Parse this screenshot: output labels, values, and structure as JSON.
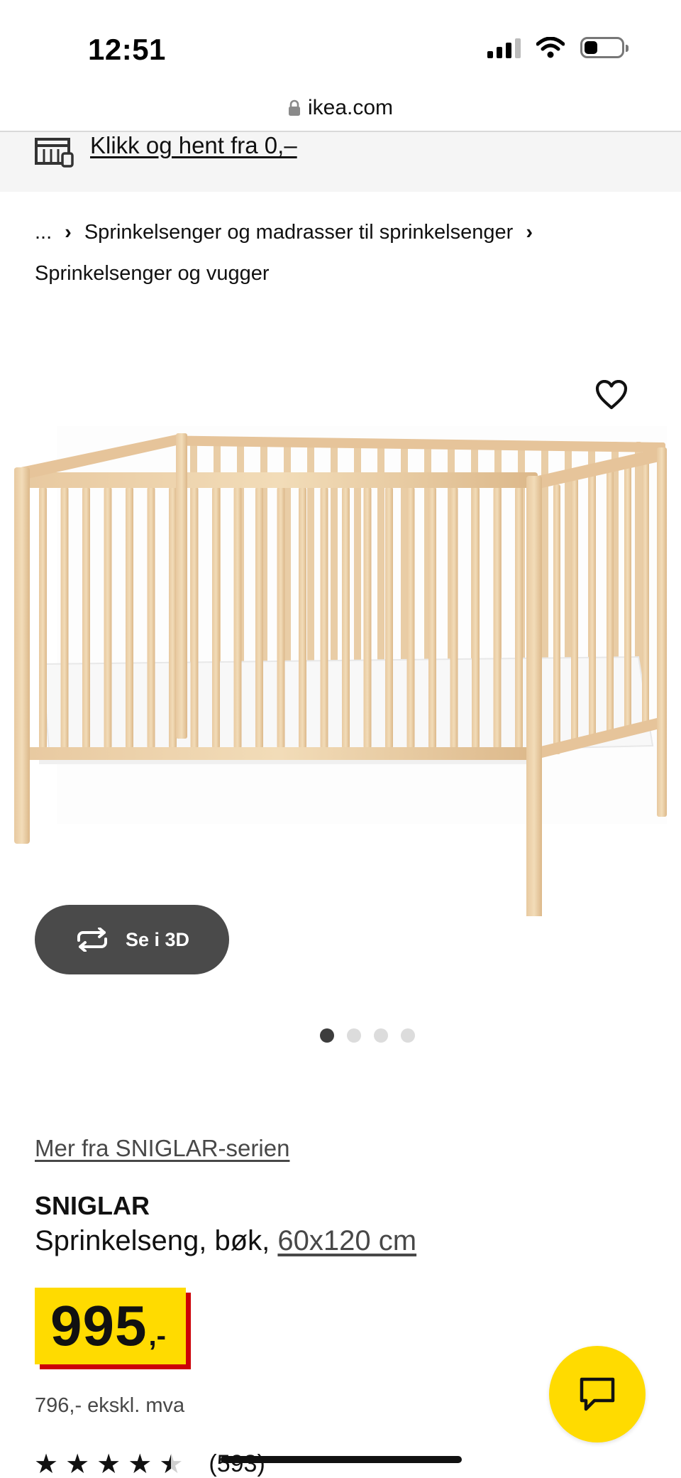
{
  "status_bar": {
    "time": "12:51"
  },
  "browser": {
    "url": "ikea.com"
  },
  "banner": {
    "text": "Klikk og hent fra 0,–"
  },
  "breadcrumb": {
    "ellipsis": "...",
    "items": [
      "Sprinkelsenger og madrasser til sprinkelsenger",
      "Sprinkelsenger og vugger"
    ]
  },
  "gallery": {
    "button_3d_label": "Se i 3D",
    "image_count": 4,
    "active_index": 0
  },
  "product": {
    "series_link": "Mer fra SNIGLAR-serien",
    "name": "SNIGLAR",
    "description": "Sprinkelseng, bøk,",
    "size_link": "60x120 cm",
    "price": "995",
    "price_suffix": ",-",
    "price_excl_vat": "796,- ekskl. mva",
    "rating_value": 4.5,
    "review_count": "(593)"
  },
  "colors": {
    "price_tag": "#ffdb00",
    "price_shadow": "#cc0008",
    "chat_button": "#ffdb00",
    "button_3d": "#4a4a4a"
  },
  "icons": {
    "wishlist": "heart-outline-icon",
    "rotate_3d": "rotate-arrows-icon",
    "chat": "chat-bubble-icon",
    "banner": "store-icon"
  }
}
